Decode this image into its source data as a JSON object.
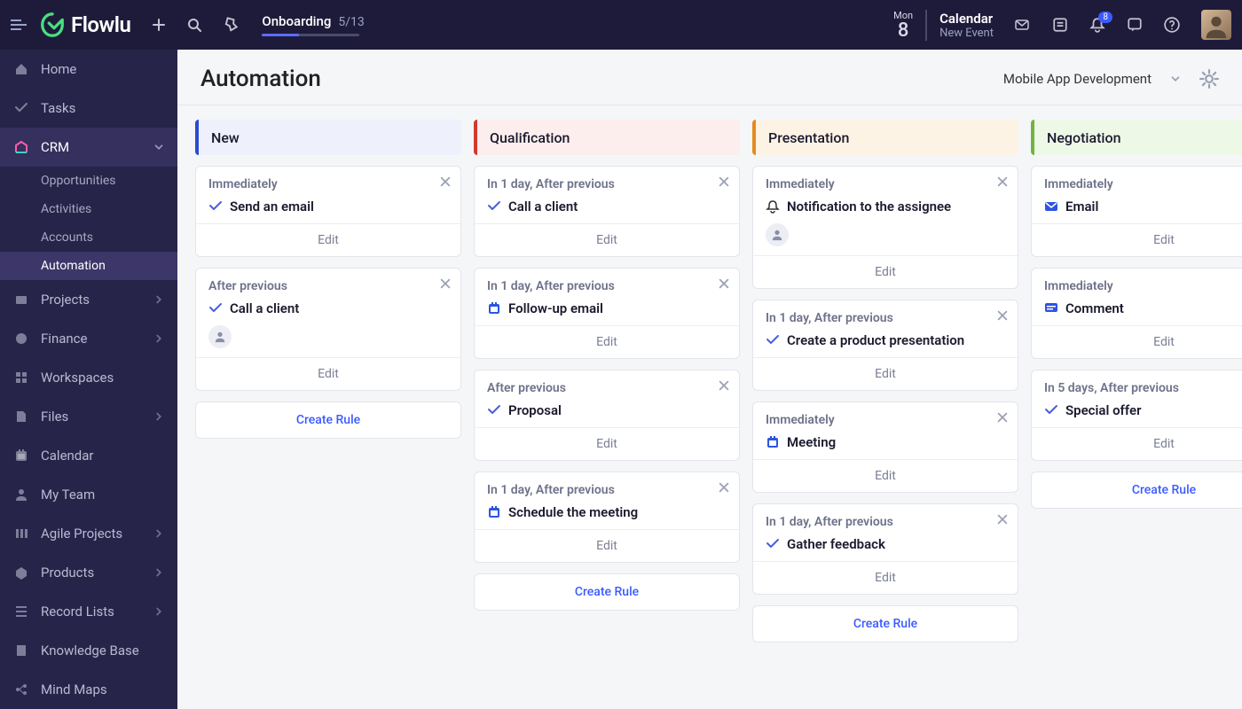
{
  "brand": "Flowlu",
  "onboarding": {
    "label": "Onboarding",
    "progress": "5/13"
  },
  "date": {
    "dow": "Mon",
    "day": "8"
  },
  "calendar": {
    "title": "Calendar",
    "sub": "New Event"
  },
  "notifications_badge": "8",
  "sidebar": {
    "items": [
      {
        "label": "Home"
      },
      {
        "label": "Tasks"
      },
      {
        "label": "CRM"
      },
      {
        "label": "Projects"
      },
      {
        "label": "Finance"
      },
      {
        "label": "Workspaces"
      },
      {
        "label": "Files"
      },
      {
        "label": "Calendar"
      },
      {
        "label": "My Team"
      },
      {
        "label": "Agile Projects"
      },
      {
        "label": "Products"
      },
      {
        "label": "Record Lists"
      },
      {
        "label": "Knowledge Base"
      },
      {
        "label": "Mind Maps"
      }
    ],
    "crm_sub": [
      {
        "label": "Opportunities"
      },
      {
        "label": "Activities"
      },
      {
        "label": "Accounts"
      },
      {
        "label": "Automation"
      }
    ]
  },
  "page": {
    "title": "Automation",
    "project": "Mobile App Development"
  },
  "columns": [
    {
      "title": "New",
      "class": "col-new",
      "cards": [
        {
          "when": "Immediately",
          "icon": "check",
          "label": "Send an email"
        },
        {
          "when": "After previous",
          "icon": "check",
          "label": "Call a client",
          "chip": true
        }
      ]
    },
    {
      "title": "Qualification",
      "class": "col-qual",
      "cards": [
        {
          "when": "In 1 day, After previous",
          "icon": "check",
          "label": "Call a client"
        },
        {
          "when": "In 1 day, After previous",
          "icon": "cal",
          "label": "Follow-up email"
        },
        {
          "when": "After previous",
          "icon": "check",
          "label": "Proposal"
        },
        {
          "when": "In 1 day, After previous",
          "icon": "cal",
          "label": "Schedule the meeting"
        }
      ]
    },
    {
      "title": "Presentation",
      "class": "col-pres",
      "cards": [
        {
          "when": "Immediately",
          "icon": "bell",
          "label": "Notification to the assignee",
          "chip": true
        },
        {
          "when": "In 1 day, After previous",
          "icon": "check",
          "label": "Create a product presentation"
        },
        {
          "when": "Immediately",
          "icon": "cal",
          "label": "Meeting"
        },
        {
          "when": "In 1 day, After previous",
          "icon": "check",
          "label": "Gather feedback"
        }
      ]
    },
    {
      "title": "Negotiation",
      "class": "col-neg",
      "cards": [
        {
          "when": "Immediately",
          "icon": "mail",
          "label": "Email"
        },
        {
          "when": "Immediately",
          "icon": "chat",
          "label": "Comment"
        },
        {
          "when": "In 5 days, After previous",
          "icon": "check",
          "label": "Special offer"
        }
      ]
    }
  ],
  "labels": {
    "edit": "Edit",
    "create_rule": "Create Rule"
  }
}
